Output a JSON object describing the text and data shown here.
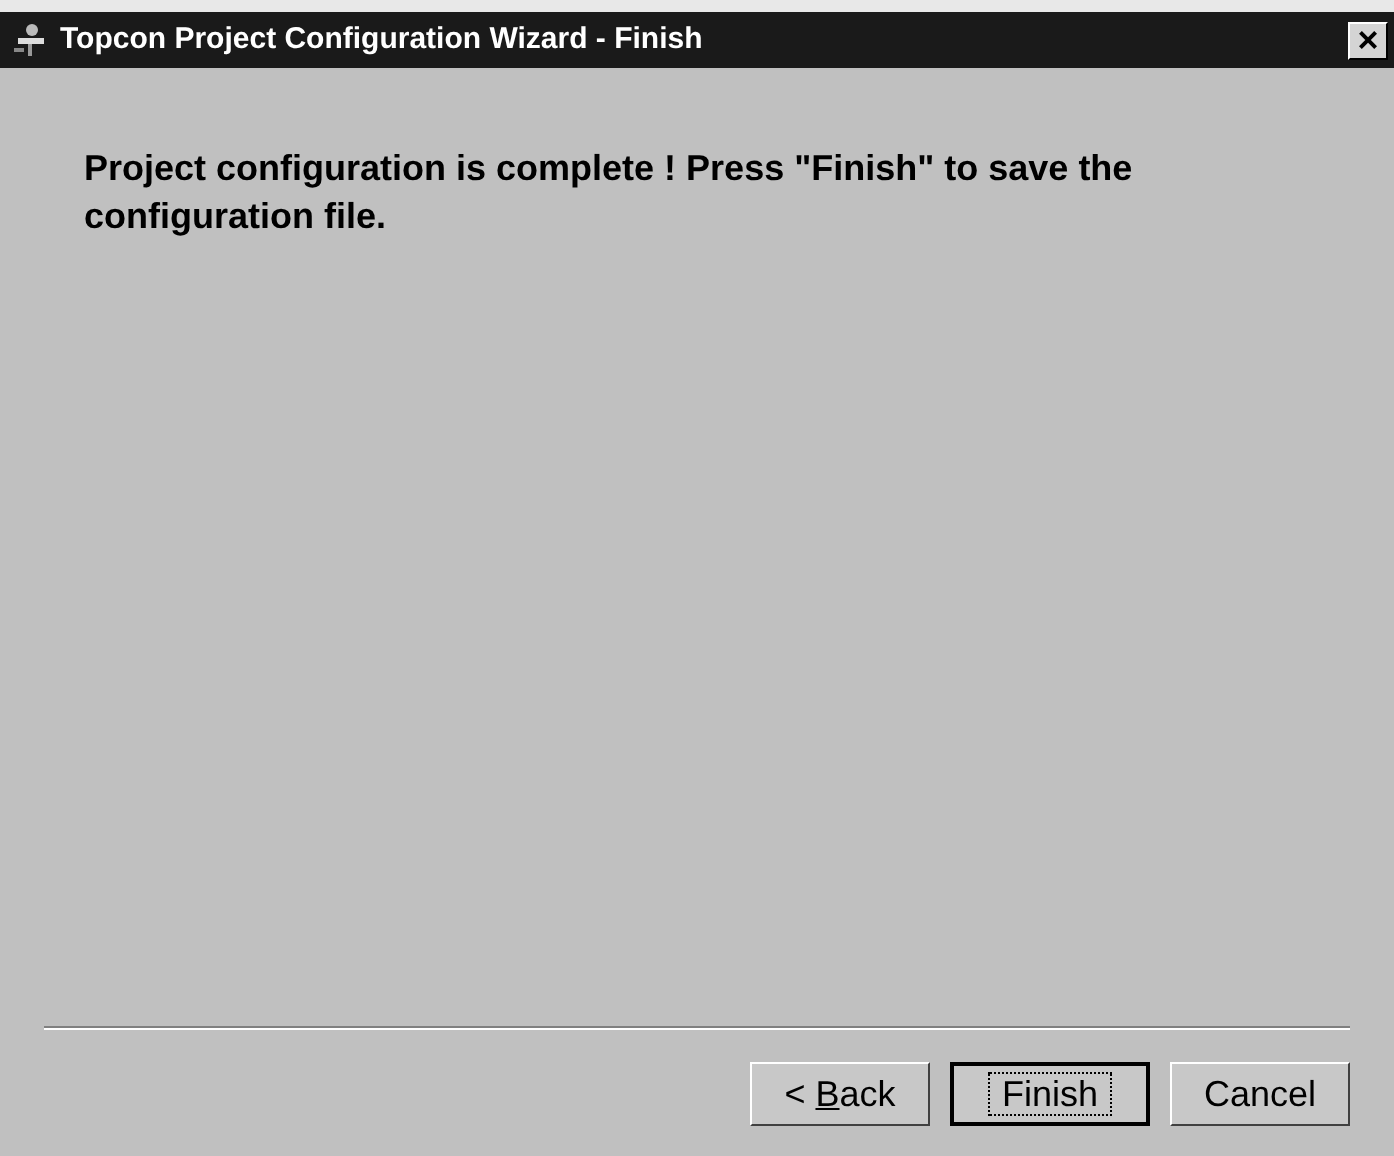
{
  "window": {
    "title": "Topcon Project Configuration Wizard - Finish",
    "close": "×"
  },
  "message": "Project configuration is complete ! Press \"Finish\" to save the configuration file.",
  "buttons": [
    {
      "label_parts": [
        "< ",
        "B",
        "ack"
      ],
      "default": false
    },
    {
      "label": "Finish",
      "default": true
    },
    {
      "label": "Cancel",
      "default": false
    }
  ]
}
